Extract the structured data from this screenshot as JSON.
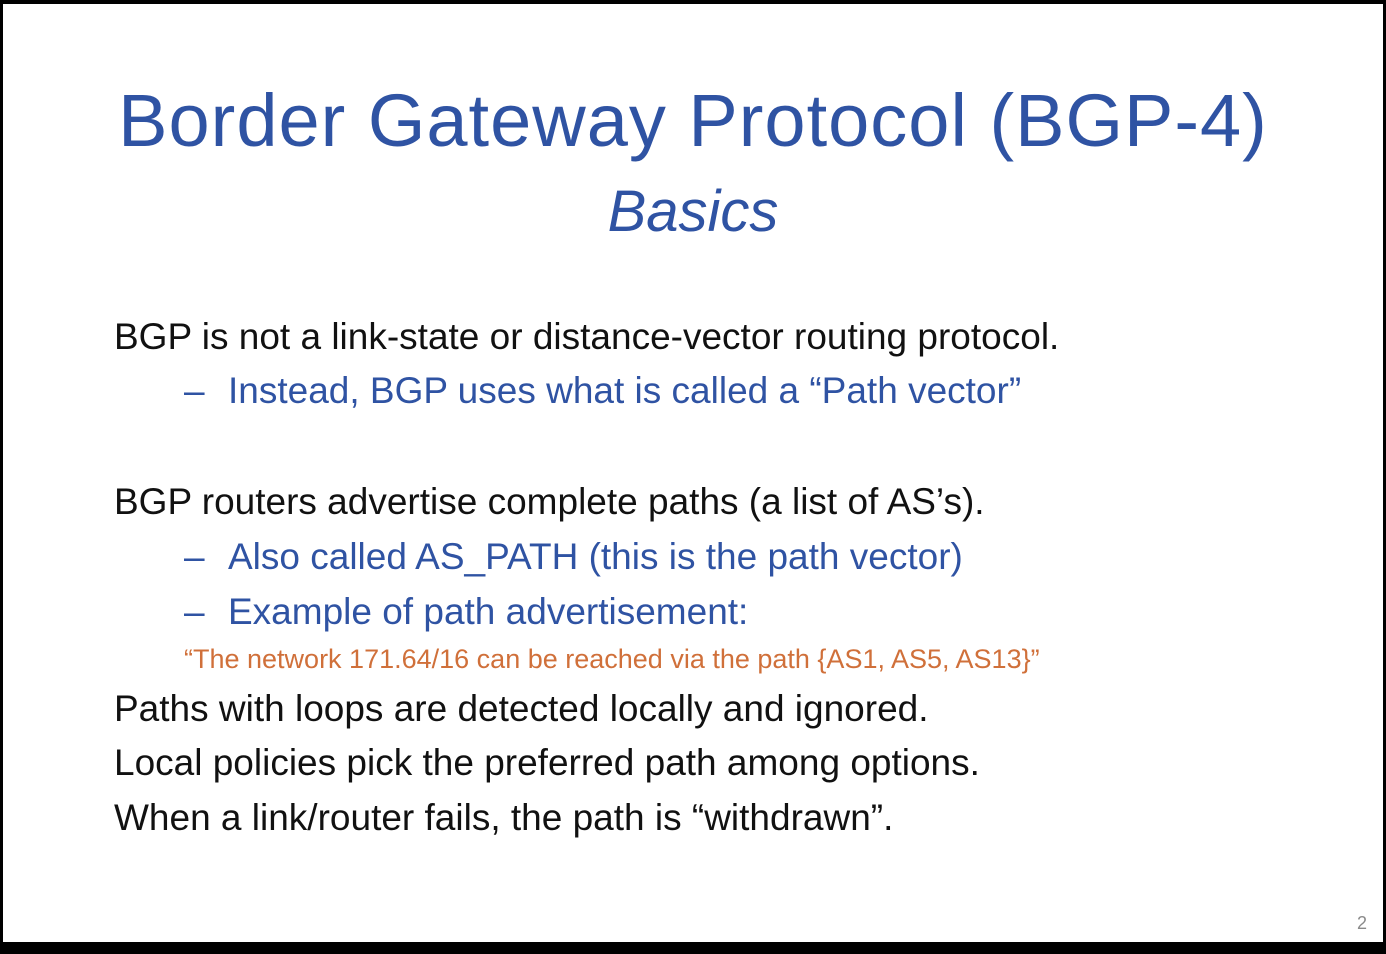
{
  "slide": {
    "title": "Border Gateway Protocol (BGP-4)",
    "subtitle": "Basics",
    "page_number": "2",
    "dash": "–",
    "bullets": [
      {
        "level": 1,
        "text": "BGP is not a link-state or distance-vector routing protocol."
      },
      {
        "level": 2,
        "text": "Instead, BGP uses what is called a “Path vector”"
      },
      {
        "level": 1,
        "text": "BGP routers advertise complete paths (a list of AS’s)."
      },
      {
        "level": 2,
        "text": "Also called AS_PATH (this is the path vector)"
      },
      {
        "level": 2,
        "text": "Example of path advertisement:"
      },
      {
        "level": 3,
        "text": "“The network 171.64/16 can be reached via the path {AS1, AS5, AS13}”"
      },
      {
        "level": 1,
        "text": "Paths with loops are detected locally and ignored."
      },
      {
        "level": 1,
        "text": "Local policies pick the preferred path among options."
      },
      {
        "level": 1,
        "text": "When a link/router fails, the path is “withdrawn”."
      }
    ],
    "colors": {
      "title": "#2f53a3",
      "body": "#111111",
      "sub_bullet": "#2f53a3",
      "example": "#d0703a",
      "background": "#ffffff"
    }
  }
}
